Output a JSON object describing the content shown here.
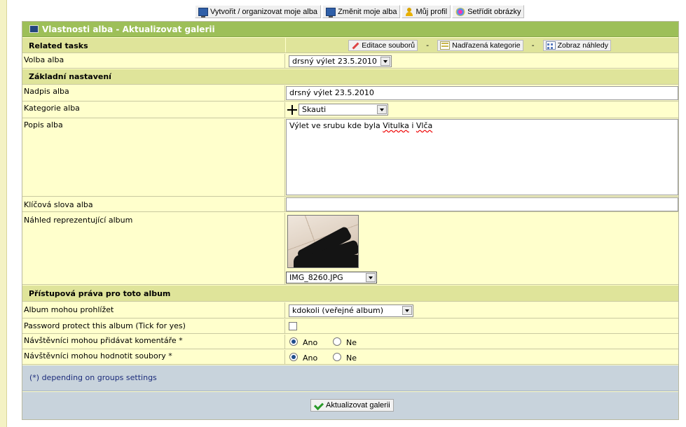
{
  "topnav": {
    "create_label": "Vytvořit / organizovat moje alba",
    "modify_label": "Změnit moje alba",
    "profile_label": "Můj profil",
    "sort_label": "Setřídit obrázky"
  },
  "panel": {
    "title": "Vlastnosti alba - Aktualizovat galerii"
  },
  "tasks": {
    "label": "Related tasks",
    "edit_files": "Editace souborů",
    "separator": "-",
    "parent_category": "Nadřazená kategorie",
    "show_thumbnails": "Zobraz náhledy"
  },
  "album_select": {
    "label": "Volba alba",
    "value": "drsný výlet 23.5.2010"
  },
  "basic": {
    "section_title": "Základní nastavení",
    "title_label": "Nadpis alba",
    "title_value": "drsný výlet 23.5.2010",
    "category_label": "Kategorie alba",
    "category_value": "Skauti",
    "description_label": "Popis alba",
    "description_prefix": "Výlet ve srubu kde byla ",
    "description_word1": "Vitulka",
    "description_mid": " i ",
    "description_word2": "Vlča",
    "keywords_label": "Klíčová slova alba",
    "keywords_value": "",
    "thumb_label": "Náhled reprezentující album",
    "thumb_file": "IMG_8260.JPG"
  },
  "access": {
    "section_title": "Přístupová práva pro toto album",
    "view_label": "Album mohou prohlížet",
    "view_value": "kdokoli (veřejné album)",
    "password_label": "Password protect this album (Tick for yes)",
    "comments_label": "Návštěvníci mohou přidávat komentáře *",
    "rating_label": "Návštěvníci mohou hodnotit soubory *",
    "yes": "Ano",
    "no": "Ne"
  },
  "note": "(*) depending on groups settings",
  "submit_label": "Aktualizovat galerii",
  "colors": {
    "title_bar": "#9dbf58",
    "section_bg": "#dfe49a",
    "panel_bg": "#ffffcc",
    "note_bg": "#c8d3dc"
  }
}
